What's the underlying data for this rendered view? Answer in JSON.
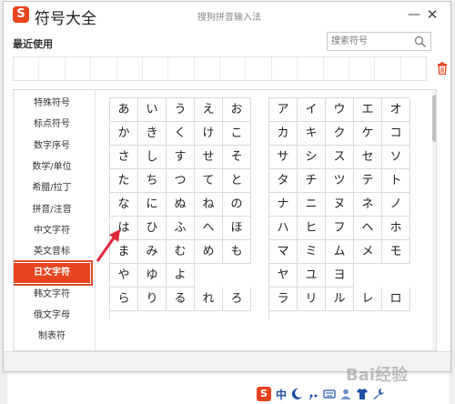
{
  "window": {
    "title": "符号大全",
    "subtitle": "搜狗拼音输入法",
    "logo_text": "S"
  },
  "recent": {
    "label": "最近使用",
    "slots": 16
  },
  "search": {
    "placeholder": "搜索符号"
  },
  "categories": [
    {
      "label": "特殊符号",
      "active": false
    },
    {
      "label": "标点符号",
      "active": false
    },
    {
      "label": "数字序号",
      "active": false
    },
    {
      "label": "数学/单位",
      "active": false
    },
    {
      "label": "希腊/拉丁",
      "active": false
    },
    {
      "label": "拼音/注音",
      "active": false
    },
    {
      "label": "中文字符",
      "active": false
    },
    {
      "label": "英文音标",
      "active": false
    },
    {
      "label": "日文字符",
      "active": true
    },
    {
      "label": "韩文字符",
      "active": false
    },
    {
      "label": "俄文字母",
      "active": false
    },
    {
      "label": "制表符",
      "active": false
    }
  ],
  "hiragana": [
    [
      "あ",
      "い",
      "う",
      "え",
      "お"
    ],
    [
      "か",
      "き",
      "く",
      "け",
      "こ"
    ],
    [
      "さ",
      "し",
      "す",
      "せ",
      "そ"
    ],
    [
      "た",
      "ち",
      "つ",
      "て",
      "と"
    ],
    [
      "な",
      "に",
      "ぬ",
      "ね",
      "の"
    ],
    [
      "は",
      "ひ",
      "ふ",
      "へ",
      "ほ"
    ],
    [
      "ま",
      "み",
      "む",
      "め",
      "も"
    ],
    [
      "や",
      "ゆ",
      "よ",
      "",
      ""
    ],
    [
      "ら",
      "り",
      "る",
      "れ",
      "ろ"
    ]
  ],
  "katakana": [
    [
      "ア",
      "イ",
      "ウ",
      "エ",
      "オ"
    ],
    [
      "カ",
      "キ",
      "ク",
      "ケ",
      "コ"
    ],
    [
      "サ",
      "シ",
      "ス",
      "セ",
      "ソ"
    ],
    [
      "タ",
      "チ",
      "ツ",
      "テ",
      "ト"
    ],
    [
      "ナ",
      "ニ",
      "ヌ",
      "ネ",
      "ノ"
    ],
    [
      "ハ",
      "ヒ",
      "フ",
      "ヘ",
      "ホ"
    ],
    [
      "マ",
      "ミ",
      "ム",
      "メ",
      "モ"
    ],
    [
      "ヤ",
      "ユ",
      "ヨ",
      "",
      ""
    ],
    [
      "ラ",
      "リ",
      "ル",
      "レ",
      "ロ"
    ]
  ],
  "taskbar": {
    "logo_text": "S",
    "lang": "中"
  },
  "watermark": {
    "text": "Bai经验"
  },
  "colors": {
    "accent": "#e8441f",
    "arrow": "#e0283c"
  },
  "icons": [
    "search-icon",
    "trash-icon",
    "minimize-icon",
    "close-icon",
    "moon-icon",
    "keyboard-icon",
    "user-icon",
    "shirt-icon",
    "wrench-icon"
  ]
}
